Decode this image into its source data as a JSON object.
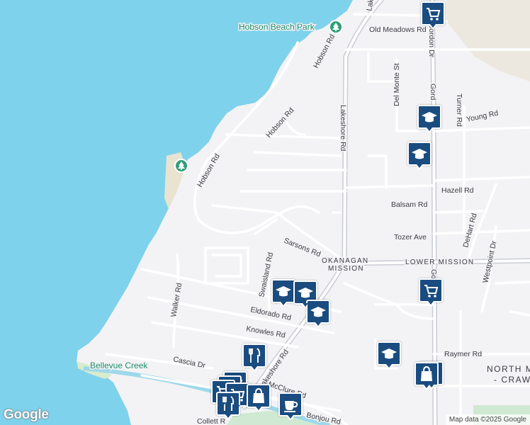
{
  "map": {
    "colors": {
      "water": "#7fd2eb",
      "land": "#f3f3f5",
      "road": "#ffffff",
      "highway": "#c9ccd3",
      "park": "#cfe9d2",
      "poi": "#1a4c80",
      "park_pin": "#2e9e78"
    },
    "parks": {
      "hobson_beach": "Hobson Beach Park"
    },
    "water": {
      "creek": "Bellevue Creek"
    },
    "areas": {
      "okanagan": "OKANAGAN",
      "mission": "MISSION",
      "lower_mission": "LOWER MISSION",
      "north_m": "NORTH M",
      "craw": "- CRAW"
    },
    "roads": {
      "lakeshore_top": "Lak",
      "lakeshore": "Lakeshore Rd",
      "lakeshore_lower": "Lakeshore Rd",
      "old_meadows": "Old Meadows Rd",
      "hobson_top": "Hobson Rd",
      "hobson_mid": "Hobson Rd",
      "hobson_left": "Hobson Rd",
      "gordon_top": "Gordon Dr",
      "gordon_mid": "Gord",
      "gordon_low": "Gor",
      "del_monte": "Del Monte St",
      "turner": "Turner Rd",
      "young": "Young Rd",
      "hazell": "Hazell Rd",
      "balsam": "Balsam Rd",
      "tozer": "Tozer Ave",
      "dehart": "DeHart Rd",
      "westpoint": "Westpoint Dr",
      "sarsons": "Sarsons Rd",
      "swaisland": "Swaisland Rd",
      "walker": "Walker Rd",
      "eldorado": "Eldorado Rd",
      "knowles": "Knowles Rd",
      "cascia": "Cascia Dr",
      "mcclure": "McClure Rd",
      "raymer": "Raymer Rd",
      "bonjou": "Bonjou Rd",
      "collett": "Collett R"
    },
    "pois": [
      {
        "name": "shopping-cart-icon",
        "label": "Grocery store"
      },
      {
        "name": "school-icon",
        "label": "School"
      },
      {
        "name": "restaurant-icon",
        "label": "Restaurant"
      },
      {
        "name": "shopping-bag-icon",
        "label": "Store"
      },
      {
        "name": "cafe-icon",
        "label": "Cafe"
      }
    ],
    "logo": "Google",
    "credits": "Map data ©2025 Google"
  }
}
